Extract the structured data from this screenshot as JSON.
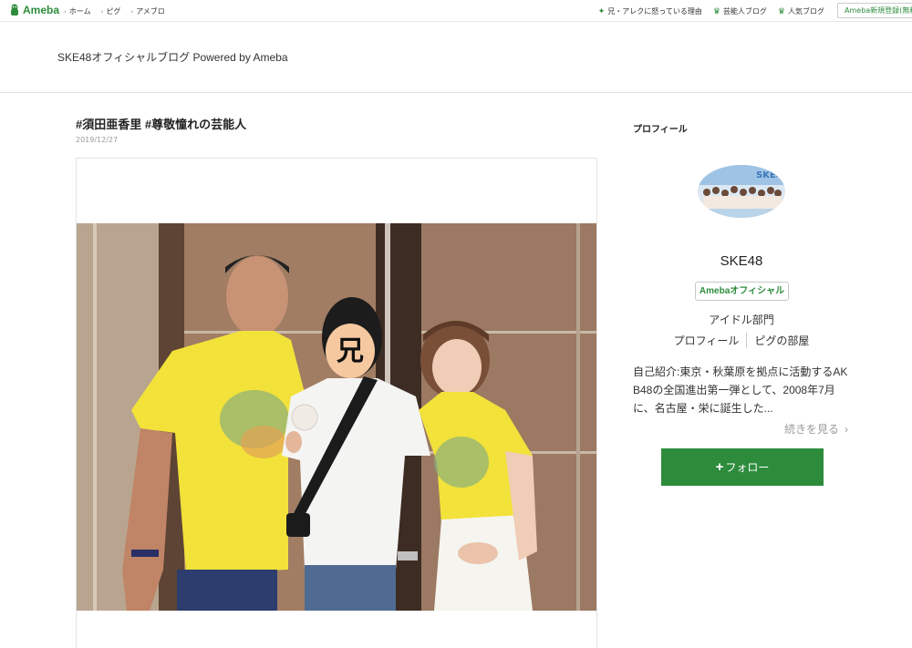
{
  "topnav": {
    "logo_text": "Ameba",
    "links": [
      "ホーム",
      "ピグ",
      "アメブロ"
    ],
    "right_links": [
      {
        "icon": "sparkle-icon",
        "label": "兄・アレクに怒っている理由"
      },
      {
        "icon": "crown-icon",
        "label": "芸能人ブログ"
      },
      {
        "icon": "crown-icon",
        "label": "人気ブログ"
      }
    ],
    "register_label": "Ameba新規登録(無料)"
  },
  "blog": {
    "title": "SKE48オフィシャルブログ Powered by Ameba"
  },
  "article": {
    "title": "#須田亜香里 #尊敬憧れの芸能人",
    "date": "2019/12/27",
    "photo_face_cover_label": "兄"
  },
  "sidebar": {
    "heading": "プロフィール",
    "avatar_text": "SKE48",
    "name": "SKE48",
    "badge": "Amebaオフィシャル",
    "genre": "アイドル部門",
    "links": [
      "プロフィール",
      "ピグの部屋"
    ],
    "intro": "自己紹介:東京・秋葉原を拠点に活動するAKB48の全国進出第一弾として、2008年7月に、名古屋・栄に誕生した...",
    "more_label": "続きを見る",
    "follow_label": "フォロー",
    "follow_prefix": "+"
  },
  "colors": {
    "brand_green": "#2d8c3c"
  }
}
